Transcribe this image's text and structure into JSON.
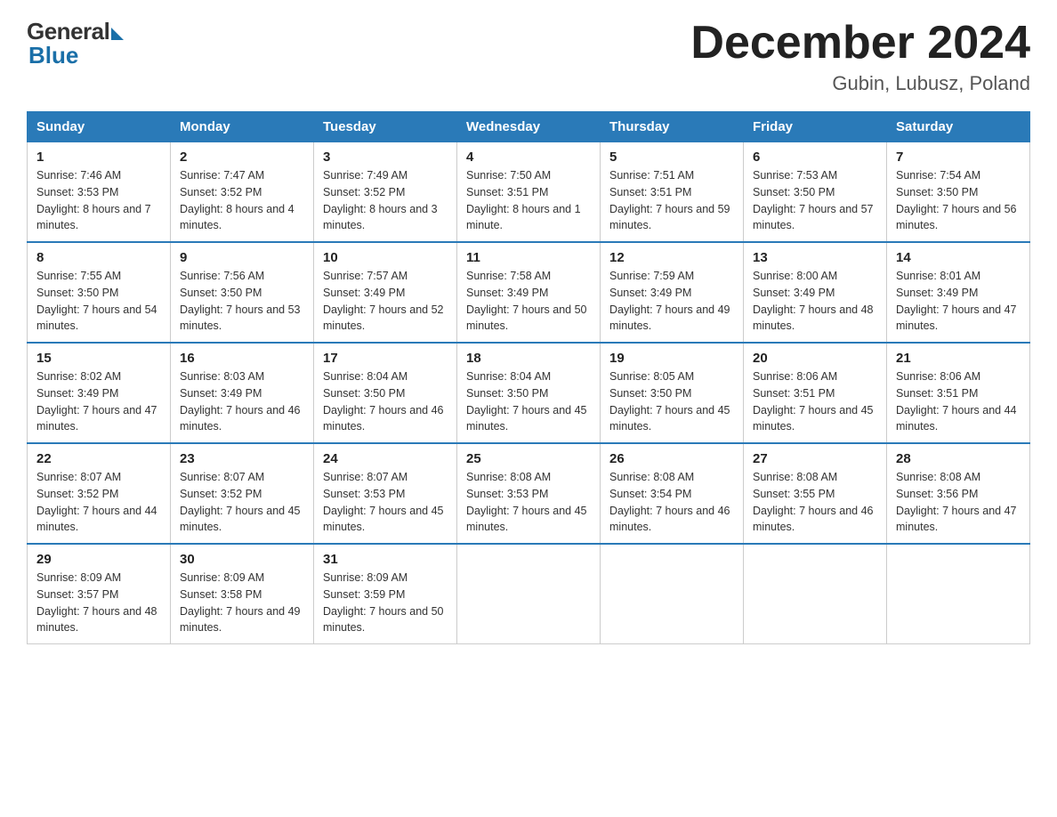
{
  "logo": {
    "general": "General",
    "blue": "Blue"
  },
  "title": "December 2024",
  "location": "Gubin, Lubusz, Poland",
  "days_of_week": [
    "Sunday",
    "Monday",
    "Tuesday",
    "Wednesday",
    "Thursday",
    "Friday",
    "Saturday"
  ],
  "weeks": [
    [
      {
        "day": "1",
        "sunrise": "7:46 AM",
        "sunset": "3:53 PM",
        "daylight": "8 hours and 7 minutes."
      },
      {
        "day": "2",
        "sunrise": "7:47 AM",
        "sunset": "3:52 PM",
        "daylight": "8 hours and 4 minutes."
      },
      {
        "day": "3",
        "sunrise": "7:49 AM",
        "sunset": "3:52 PM",
        "daylight": "8 hours and 3 minutes."
      },
      {
        "day": "4",
        "sunrise": "7:50 AM",
        "sunset": "3:51 PM",
        "daylight": "8 hours and 1 minute."
      },
      {
        "day": "5",
        "sunrise": "7:51 AM",
        "sunset": "3:51 PM",
        "daylight": "7 hours and 59 minutes."
      },
      {
        "day": "6",
        "sunrise": "7:53 AM",
        "sunset": "3:50 PM",
        "daylight": "7 hours and 57 minutes."
      },
      {
        "day": "7",
        "sunrise": "7:54 AM",
        "sunset": "3:50 PM",
        "daylight": "7 hours and 56 minutes."
      }
    ],
    [
      {
        "day": "8",
        "sunrise": "7:55 AM",
        "sunset": "3:50 PM",
        "daylight": "7 hours and 54 minutes."
      },
      {
        "day": "9",
        "sunrise": "7:56 AM",
        "sunset": "3:50 PM",
        "daylight": "7 hours and 53 minutes."
      },
      {
        "day": "10",
        "sunrise": "7:57 AM",
        "sunset": "3:49 PM",
        "daylight": "7 hours and 52 minutes."
      },
      {
        "day": "11",
        "sunrise": "7:58 AM",
        "sunset": "3:49 PM",
        "daylight": "7 hours and 50 minutes."
      },
      {
        "day": "12",
        "sunrise": "7:59 AM",
        "sunset": "3:49 PM",
        "daylight": "7 hours and 49 minutes."
      },
      {
        "day": "13",
        "sunrise": "8:00 AM",
        "sunset": "3:49 PM",
        "daylight": "7 hours and 48 minutes."
      },
      {
        "day": "14",
        "sunrise": "8:01 AM",
        "sunset": "3:49 PM",
        "daylight": "7 hours and 47 minutes."
      }
    ],
    [
      {
        "day": "15",
        "sunrise": "8:02 AM",
        "sunset": "3:49 PM",
        "daylight": "7 hours and 47 minutes."
      },
      {
        "day": "16",
        "sunrise": "8:03 AM",
        "sunset": "3:49 PM",
        "daylight": "7 hours and 46 minutes."
      },
      {
        "day": "17",
        "sunrise": "8:04 AM",
        "sunset": "3:50 PM",
        "daylight": "7 hours and 46 minutes."
      },
      {
        "day": "18",
        "sunrise": "8:04 AM",
        "sunset": "3:50 PM",
        "daylight": "7 hours and 45 minutes."
      },
      {
        "day": "19",
        "sunrise": "8:05 AM",
        "sunset": "3:50 PM",
        "daylight": "7 hours and 45 minutes."
      },
      {
        "day": "20",
        "sunrise": "8:06 AM",
        "sunset": "3:51 PM",
        "daylight": "7 hours and 45 minutes."
      },
      {
        "day": "21",
        "sunrise": "8:06 AM",
        "sunset": "3:51 PM",
        "daylight": "7 hours and 44 minutes."
      }
    ],
    [
      {
        "day": "22",
        "sunrise": "8:07 AM",
        "sunset": "3:52 PM",
        "daylight": "7 hours and 44 minutes."
      },
      {
        "day": "23",
        "sunrise": "8:07 AM",
        "sunset": "3:52 PM",
        "daylight": "7 hours and 45 minutes."
      },
      {
        "day": "24",
        "sunrise": "8:07 AM",
        "sunset": "3:53 PM",
        "daylight": "7 hours and 45 minutes."
      },
      {
        "day": "25",
        "sunrise": "8:08 AM",
        "sunset": "3:53 PM",
        "daylight": "7 hours and 45 minutes."
      },
      {
        "day": "26",
        "sunrise": "8:08 AM",
        "sunset": "3:54 PM",
        "daylight": "7 hours and 46 minutes."
      },
      {
        "day": "27",
        "sunrise": "8:08 AM",
        "sunset": "3:55 PM",
        "daylight": "7 hours and 46 minutes."
      },
      {
        "day": "28",
        "sunrise": "8:08 AM",
        "sunset": "3:56 PM",
        "daylight": "7 hours and 47 minutes."
      }
    ],
    [
      {
        "day": "29",
        "sunrise": "8:09 AM",
        "sunset": "3:57 PM",
        "daylight": "7 hours and 48 minutes."
      },
      {
        "day": "30",
        "sunrise": "8:09 AM",
        "sunset": "3:58 PM",
        "daylight": "7 hours and 49 minutes."
      },
      {
        "day": "31",
        "sunrise": "8:09 AM",
        "sunset": "3:59 PM",
        "daylight": "7 hours and 50 minutes."
      },
      null,
      null,
      null,
      null
    ]
  ]
}
